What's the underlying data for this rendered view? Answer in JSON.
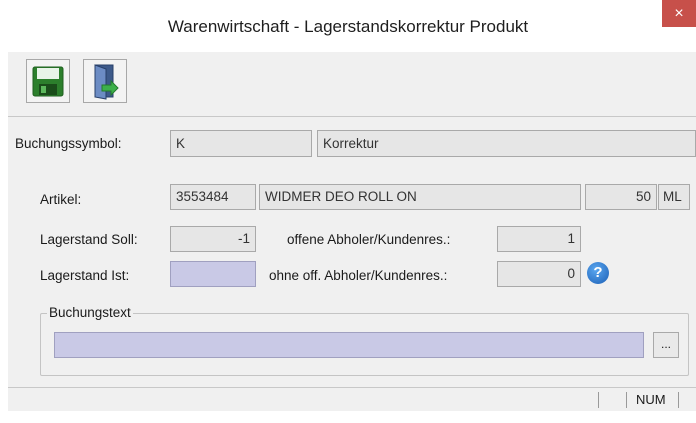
{
  "window": {
    "title": "Warenwirtschaft - Lagerstandskorrektur Produkt",
    "close_label": "×"
  },
  "toolbar": {
    "buttons": [
      {
        "icon": "save-floppy-icon"
      },
      {
        "icon": "exit-door-icon"
      }
    ]
  },
  "form": {
    "buchungssymbol_label": "Buchungssymbol:",
    "buchungssymbol_code": "K",
    "buchungssymbol_text": "Korrektur",
    "artikel_label": "Artikel:",
    "artikel_nr": "3553484",
    "artikel_name": "WIDMER DEO ROLL ON",
    "artikel_menge": "50",
    "artikel_einheit": "ML",
    "lagerstand_soll_label": "Lagerstand Soll:",
    "lagerstand_soll": "-1",
    "offene_abholer_label": "offene Abholer/Kundenres.:",
    "offene_abholer": "1",
    "lagerstand_ist_label": "Lagerstand Ist:",
    "lagerstand_ist": "",
    "ohne_abholer_label": "ohne off. Abholer/Kundenres.:",
    "ohne_abholer": "0",
    "help_label": "?",
    "buchungstext_label": "Buchungstext",
    "buchungstext": "",
    "dots_label": "..."
  },
  "statusbar": {
    "num": "NUM"
  },
  "colors": {
    "editable_field": "#c9c9e6",
    "readonly_field": "#e6e6e6",
    "close_button": "#c7504a",
    "background": "#f0f0f0"
  }
}
